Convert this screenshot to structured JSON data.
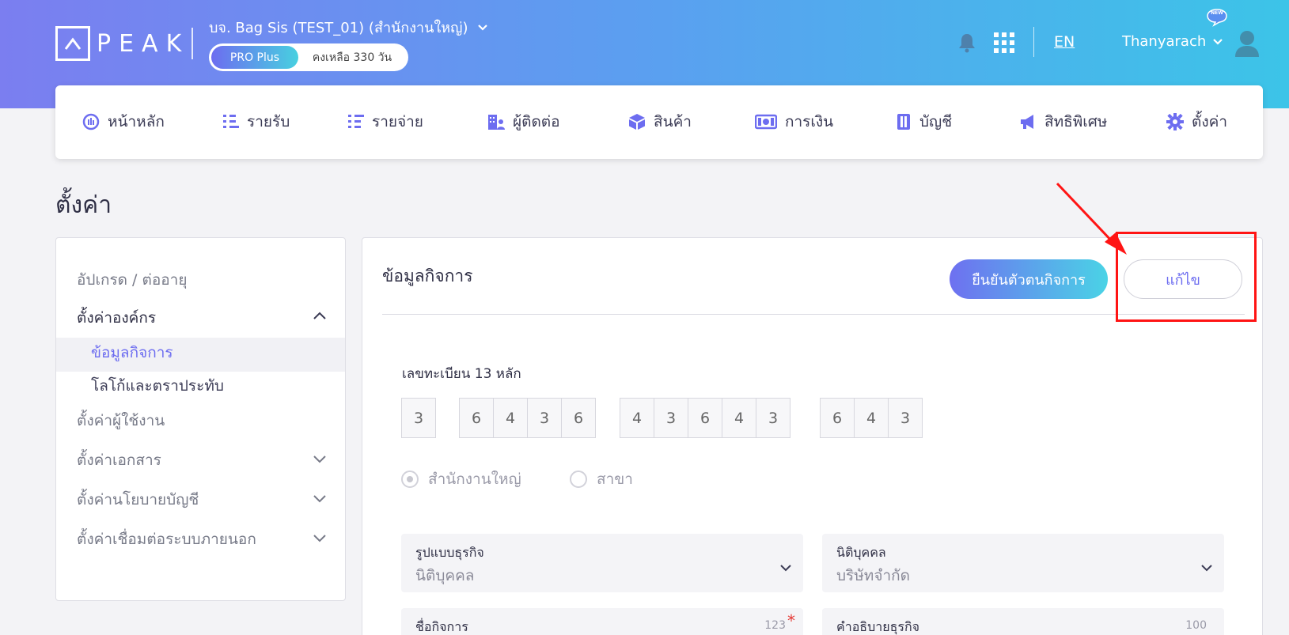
{
  "header": {
    "logo_text": "PEAK",
    "company_name": "บจ. Bag Sis (TEST_01) (สำนักงานใหญ่)",
    "plan": "PRO Plus",
    "remaining": "คงเหลือ 330 วัน",
    "language": "EN",
    "user_name": "Thanyarach",
    "new_badge": "NEW"
  },
  "nav": {
    "items": [
      {
        "label": "หน้าหลัก",
        "icon": "dashboard-icon"
      },
      {
        "label": "รายรับ",
        "icon": "income-icon"
      },
      {
        "label": "รายจ่าย",
        "icon": "expense-icon"
      },
      {
        "label": "ผู้ติดต่อ",
        "icon": "contacts-icon"
      },
      {
        "label": "สินค้า",
        "icon": "product-box-icon"
      },
      {
        "label": "การเงิน",
        "icon": "money-icon"
      },
      {
        "label": "บัญชี",
        "icon": "ledger-icon"
      },
      {
        "label": "สิทธิพิเศษ",
        "icon": "megaphone-icon"
      },
      {
        "label": "ตั้งค่า",
        "icon": "gear-icon"
      }
    ]
  },
  "page_title": "ตั้งค่า",
  "sidebar": {
    "items": [
      {
        "label": "อัปเกรด / ต่ออายุ"
      },
      {
        "label": "ตั้งค่าองค์กร"
      },
      {
        "label": "ข้อมูลกิจการ"
      },
      {
        "label": "โลโก้และตราประทับ"
      },
      {
        "label": "ตั้งค่าผู้ใช้งาน"
      },
      {
        "label": "ตั้งค่าเอกสาร"
      },
      {
        "label": "ตั้งค่านโยบายบัญชี"
      },
      {
        "label": "ตั้งค่าเชื่อมต่อระบบภายนอก"
      }
    ]
  },
  "main": {
    "title": "ข้อมูลกิจการ",
    "verify_button": "ยืนยันตัวตนกิจการ",
    "edit_button": "แก้ไข",
    "tax_label": "เลขทะเบียน 13 หลัก",
    "tax_digits": [
      "3",
      "6",
      "4",
      "3",
      "6",
      "4",
      "3",
      "6",
      "4",
      "3",
      "6",
      "4",
      "3"
    ],
    "radio_head_office": "สำนักงานใหญ่",
    "radio_branch": "สาขา",
    "fields": {
      "business_type": {
        "label": "รูปแบบธุรกิจ",
        "value": "นิติบุคคล"
      },
      "juristic": {
        "label": "นิติบุคคล",
        "value": "บริษัทจำกัด"
      },
      "business_name": {
        "label": "ชื่อกิจการ",
        "counter": "123",
        "required": "*"
      },
      "business_desc": {
        "label": "คำอธิบายธุรกิจ",
        "counter": "100"
      }
    }
  },
  "colors": {
    "accent": "#6d6df0",
    "annotation": "#ff1414"
  }
}
